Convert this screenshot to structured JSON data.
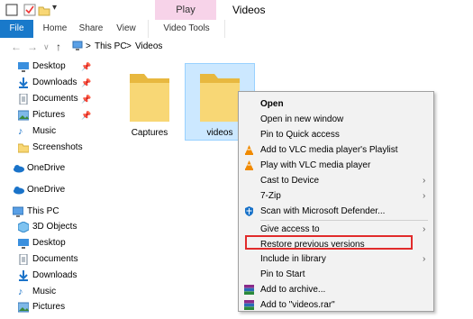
{
  "window": {
    "title": "Videos"
  },
  "ribbon": {
    "contextual_group": "Play",
    "tabs": [
      "File",
      "Home",
      "Share",
      "View",
      "Video Tools"
    ]
  },
  "address": {
    "crumbs": [
      "This PC",
      "Videos"
    ],
    "separator": ">"
  },
  "sidebar": {
    "quick_access": [
      {
        "label": "Desktop",
        "icon": "desktop-icon",
        "pinned": true
      },
      {
        "label": "Downloads",
        "icon": "download-icon",
        "pinned": true
      },
      {
        "label": "Documents",
        "icon": "documents-icon",
        "pinned": true
      },
      {
        "label": "Pictures",
        "icon": "pictures-icon",
        "pinned": true
      },
      {
        "label": "Music",
        "icon": "music-icon",
        "pinned": false
      },
      {
        "label": "Screenshots",
        "icon": "folder-icon",
        "pinned": false
      }
    ],
    "onedrive_1": "OneDrive",
    "onedrive_2": "OneDrive",
    "this_pc": "This PC",
    "this_pc_items": [
      {
        "label": "3D Objects",
        "icon": "objects-3d-icon"
      },
      {
        "label": "Desktop",
        "icon": "desktop-icon"
      },
      {
        "label": "Documents",
        "icon": "documents-icon"
      },
      {
        "label": "Downloads",
        "icon": "download-icon"
      },
      {
        "label": "Music",
        "icon": "music-icon"
      },
      {
        "label": "Pictures",
        "icon": "pictures-icon"
      }
    ]
  },
  "folders": [
    {
      "label": "Captures",
      "selected": false
    },
    {
      "label": "videos",
      "selected": true
    }
  ],
  "context_menu": {
    "items": [
      {
        "label": "Open",
        "bold": true,
        "icon": null,
        "submenu": false
      },
      {
        "label": "Open in new window",
        "icon": null,
        "submenu": false
      },
      {
        "label": "Pin to Quick access",
        "icon": null,
        "submenu": false
      },
      {
        "label": "Add to VLC media player's Playlist",
        "icon": "vlc-icon",
        "submenu": false
      },
      {
        "label": "Play with VLC media player",
        "icon": "vlc-icon",
        "submenu": false
      },
      {
        "label": "Cast to Device",
        "icon": null,
        "submenu": true
      },
      {
        "label": "7-Zip",
        "icon": null,
        "submenu": true
      },
      {
        "label": "Scan with Microsoft Defender...",
        "icon": "defender-icon",
        "submenu": false
      },
      {
        "label": "Give access to",
        "icon": null,
        "submenu": true
      },
      {
        "label": "Restore previous versions",
        "icon": null,
        "submenu": false,
        "highlighted": true
      },
      {
        "label": "Include in library",
        "icon": null,
        "submenu": true
      },
      {
        "label": "Pin to Start",
        "icon": null,
        "submenu": false
      },
      {
        "label": "Add to archive...",
        "icon": "winrar-icon",
        "submenu": false
      },
      {
        "label": "Add to \"videos.rar\"",
        "icon": "winrar-icon",
        "submenu": false
      }
    ]
  },
  "colors": {
    "file_tab": "#1979ca",
    "play_tab": "#f7d3e9",
    "selection": "#cce8ff",
    "highlight_box": "#e12b2b",
    "folder": "#f8d775"
  }
}
